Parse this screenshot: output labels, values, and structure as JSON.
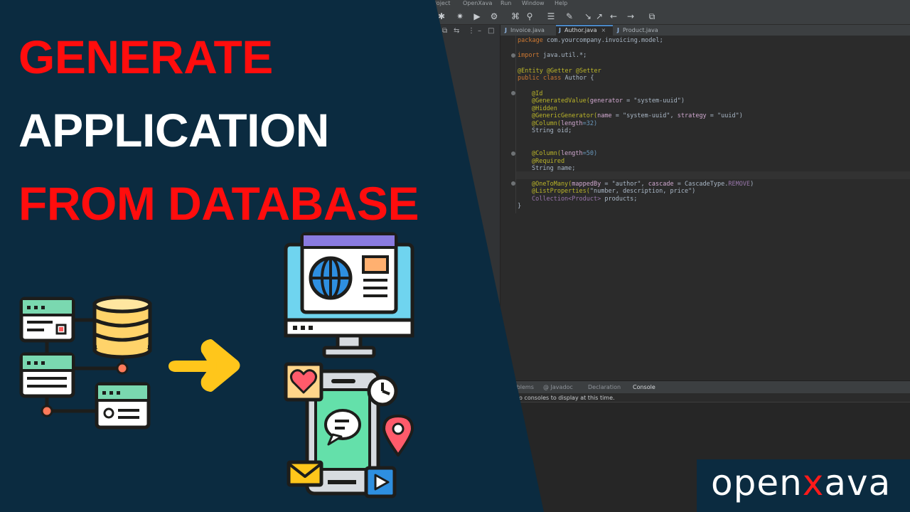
{
  "menu": [
    "Project",
    "OpenXava",
    "Run",
    "Window",
    "Help"
  ],
  "editor_tabs": [
    {
      "label": "Invoice.java",
      "active": false
    },
    {
      "label": "Author.java",
      "active": true
    },
    {
      "label": "Product.java",
      "active": false
    }
  ],
  "code": {
    "package_kw": "package",
    "package_name": " com.yourcompany.invoicing.model;",
    "import_kw": "import",
    "import_name": " java.util.*;",
    "class_annotations": "@Entity @Getter @Setter",
    "class_kw": "public class",
    "class_name": " Author {",
    "id_ann": "@Id",
    "gen_ann": "@GeneratedValue(",
    "gen_param": "generator",
    "gen_value": " = \"system-uuid\")",
    "hidden_ann": "@Hidden",
    "gg_ann": "@GenericGenerator(",
    "gg_name_param": "name",
    "gg_name_value": " = \"system-uuid\", ",
    "gg_strategy_param": "strategy",
    "gg_strategy_value": " = \"uuid\")",
    "col32_ann": "@Column(",
    "col32_param": "length",
    "col32_value": "=32)",
    "oid_field": "String oid;",
    "col50_ann": "@Column(",
    "col50_param": "length",
    "col50_value": "=50)",
    "required_ann": "@Required",
    "name_field": "String name;",
    "otm_ann": "@OneToMany(",
    "otm_mapped_param": "mappedBy",
    "otm_mapped_value": " = \"author\", ",
    "otm_cascade_param": "cascade",
    "otm_cascade_value": " = CascadeType.",
    "otm_remove": "REMOVE",
    "otm_close": ")",
    "list_ann": "@ListProperties(",
    "list_value": "\"number, description, price\")",
    "collection_type": "Collection<Product>",
    "collection_name": " products;",
    "closing_brace": "}"
  },
  "bottom_tabs": [
    {
      "label": "Problems",
      "active": false
    },
    {
      "label": "@ Javadoc",
      "active": false
    },
    {
      "label": "Declaration",
      "active": false
    },
    {
      "label": "Console",
      "active": true
    }
  ],
  "console_message": "No consoles to display at this time.",
  "headline": {
    "line1": "GENERATE",
    "line2": "APPLICATION",
    "line3": "FROM DATABASE"
  },
  "logo": {
    "part1": "open",
    "part2": "x",
    "part3": "ava"
  },
  "colors": {
    "navy": "#0b2b40",
    "headline_red": "#ff0d0d",
    "arrow_yellow": "#ffc61b",
    "ide_bg": "#2b2b2b"
  },
  "icons": [
    "database-icon",
    "server-rack-icon",
    "arrow-right-icon",
    "monitor-globe-icon",
    "smartphone-chat-icon",
    "heart-icon",
    "clock-icon",
    "location-pin-icon",
    "mail-icon",
    "play-icon"
  ]
}
